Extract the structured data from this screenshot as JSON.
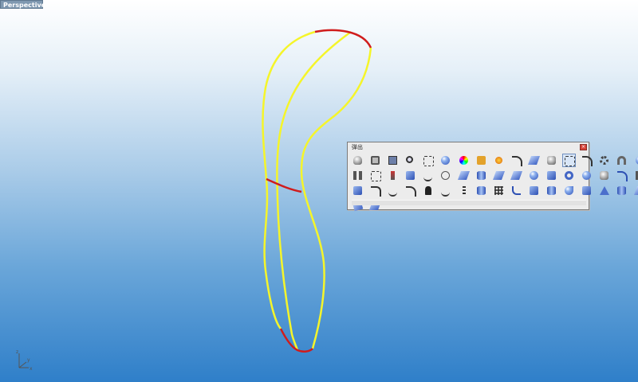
{
  "viewport": {
    "title": "Perspective",
    "background_top": "#ffffff",
    "background_bottom": "#2f7fc9",
    "axis_labels": [
      "z",
      "y",
      "x"
    ]
  },
  "curves": {
    "primary_color": "#f5f52a",
    "highlight_color": "#d01c1c"
  },
  "popup": {
    "title": "弹出",
    "close_glyph": "×",
    "rows": [
      [
        "light-bulb-icon",
        "lock-icon",
        "save-icon",
        "zoom-extents-icon",
        "zoom-window-icon",
        "render-sphere-icon",
        "color-wheel-icon",
        "paint-bucket-icon",
        "spark-icon",
        "curve-icon",
        "layer-icon",
        "move-icon",
        "snap-icon",
        "arc-icon",
        "gear-icon",
        "arch-icon",
        "shell-icon"
      ],
      [
        "mirror-icon",
        "points-icon",
        "bolt-icon",
        "box-icon",
        "wave-icon",
        "rotate-icon",
        "stack-icon",
        "cylinder-icon",
        "surface-icon",
        "plane-icon",
        "sphere-icon",
        "cube-icon",
        "torus-icon",
        "cone-icon",
        "blend-icon",
        "extrude-icon",
        "pipe-icon"
      ],
      [
        "solid-box-icon",
        "polyline-icon",
        "spline-icon",
        "freeform-icon",
        "walk-icon",
        "zigzag-icon",
        "ladder-icon",
        "cylinder-tube-icon",
        "grid-icon",
        "fillet-icon",
        "ruled-icon",
        "capsule-icon",
        "cut-icon",
        "panel-icon",
        "tower-icon",
        "disc-icon",
        "patch-icon"
      ],
      [
        "rotate-sheet-icon",
        "flat-sheet-icon"
      ]
    ]
  }
}
